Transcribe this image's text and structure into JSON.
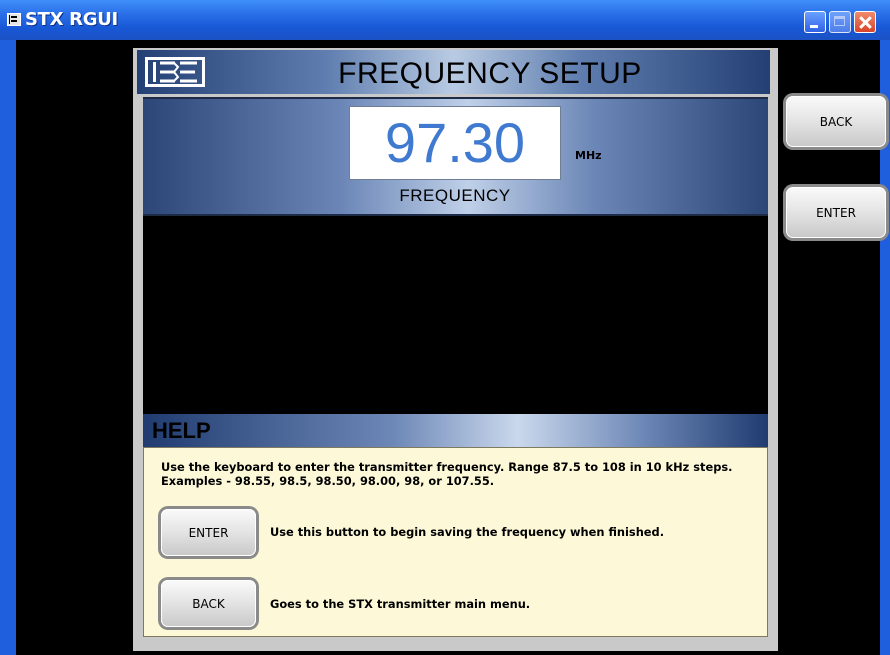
{
  "window": {
    "title": "STX RGUI"
  },
  "header": {
    "title": "FREQUENCY SETUP",
    "logo": "BE logo"
  },
  "frequency": {
    "value": "97.30",
    "unit": "MHz",
    "label": "FREQUENCY"
  },
  "side_buttons": {
    "back": "BACK",
    "enter": "ENTER"
  },
  "help": {
    "title": "HELP",
    "line1": "Use the keyboard to enter the transmitter frequency. Range 87.5 to 108 in 10 kHz steps.",
    "line2": "Examples - 98.55, 98.5, 98.50, 98.00, 98, or 107.55.",
    "enter_button": "ENTER",
    "enter_desc": "Use this button to begin saving the frequency when finished.",
    "back_button": "BACK",
    "back_desc": "Goes to the STX transmitter main menu."
  },
  "icons": [
    "app-icon",
    "minimize-icon",
    "maximize-icon",
    "close-icon"
  ],
  "colors": {
    "titlebar": "#2a6fe8",
    "frequency_text": "#3f7ad0",
    "help_background": "#fdf9d8"
  }
}
